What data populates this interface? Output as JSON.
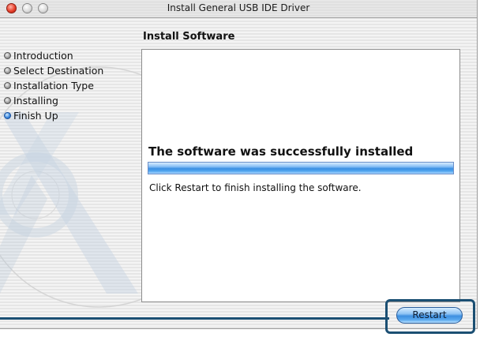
{
  "window": {
    "title": "Install General USB IDE Driver",
    "controls": [
      "close",
      "minimize",
      "zoom"
    ]
  },
  "page": {
    "title": "Install Software"
  },
  "steps": [
    {
      "label": "Introduction",
      "current": false
    },
    {
      "label": "Select Destination",
      "current": false
    },
    {
      "label": "Installation Type",
      "current": false
    },
    {
      "label": "Installing",
      "current": false
    },
    {
      "label": "Finish Up",
      "current": true
    }
  ],
  "content": {
    "heading": "The software was successfully installed",
    "progress": 1.0,
    "message": "Click Restart to finish installing the software."
  },
  "buttons": {
    "restart_label": "Restart"
  },
  "colors": {
    "accent": "#3c8fe3",
    "callout": "#1b4f73",
    "close_button": "#e8412c"
  },
  "icons": {
    "step_bullet": "bullet-icon",
    "background_logo": "mac-os-x-logo"
  }
}
